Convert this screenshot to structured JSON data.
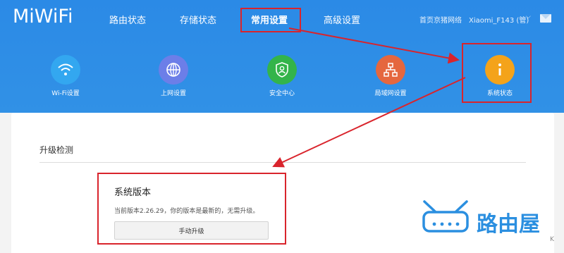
{
  "header": {
    "logo": "MiWiFi",
    "nav": [
      "路由状态",
      "存储状态",
      "常用设置",
      "高级设置"
    ],
    "right_links": [
      "首页京猪网络",
      "Xiaomi_F143 (管)"
    ],
    "mail_icon": "mail-icon"
  },
  "shortcuts": [
    {
      "label": "Wi-Fi设置",
      "icon": "wifi-icon",
      "color": "#33a7f0"
    },
    {
      "label": "上网设置",
      "icon": "globe-icon",
      "color": "#6c7ee8"
    },
    {
      "label": "安全中心",
      "icon": "shield-user-icon",
      "color": "#33b44a"
    },
    {
      "label": "局域网设置",
      "icon": "network-icon",
      "color": "#e5673e"
    },
    {
      "label": "系统状态",
      "icon": "info-icon",
      "color": "#f4a31a"
    }
  ],
  "content": {
    "section_title": "升级检测",
    "version_title": "系统版本",
    "version_text": "当前版本2.26.29，你的版本是最新的，无需升级。",
    "upgrade_button": "手动升级"
  },
  "watermark": {
    "text": "路由屋"
  },
  "stray_text": "K",
  "colors": {
    "accent_blue": "#2f8de4",
    "highlight_red": "#d9242c"
  }
}
